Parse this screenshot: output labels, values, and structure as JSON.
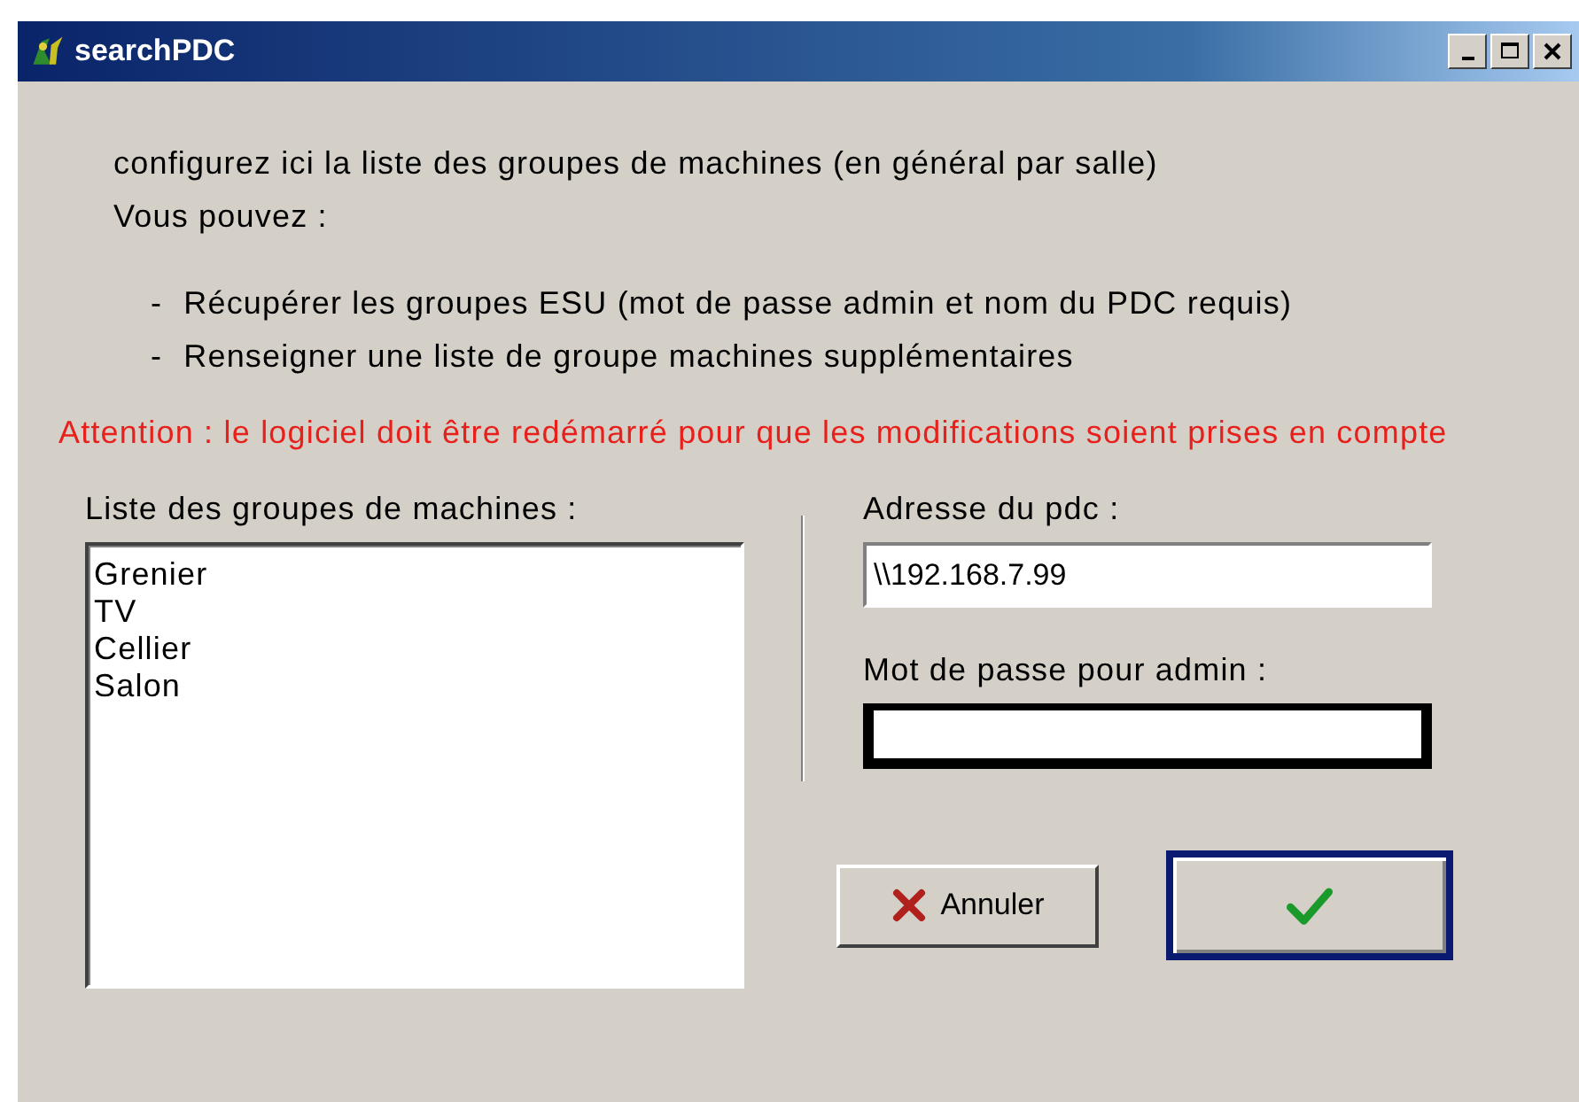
{
  "window": {
    "title": "searchPDC"
  },
  "intro": [
    "configurez ici la liste des groupes de machines (en général par salle)",
    "Vous pouvez  :"
  ],
  "bullets": [
    {
      "mark": "-",
      "text": "Récupérer les groupes ESU (mot de passe admin et nom du PDC requis)"
    },
    {
      "mark": "-",
      "text": "Renseigner une liste de groupe machines supplémentaires"
    }
  ],
  "warning": "Attention : le logiciel doit être redémarré pour que les modifications soient prises en compte",
  "groups": {
    "label": "Liste des groupes de machines :",
    "items": [
      "Grenier",
      "TV",
      "Cellier",
      "Salon"
    ]
  },
  "pdc_address": {
    "label": "Adresse du pdc :",
    "value": "\\\\192.168.7.99"
  },
  "admin_password": {
    "label": "Mot de passe pour admin :",
    "focused": true
  },
  "buttons": [
    {
      "kind": "cancel",
      "label": "Annuler",
      "default": false
    },
    {
      "kind": "ok",
      "default": true
    }
  ]
}
